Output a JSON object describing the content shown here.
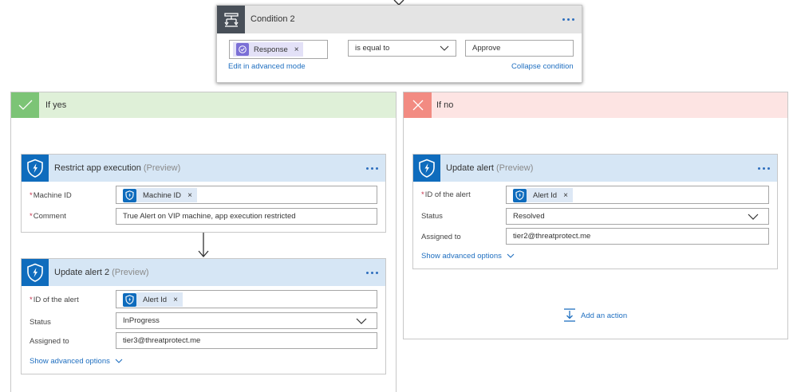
{
  "condition": {
    "title": "Condition 2",
    "left_token": "Response",
    "operator": "is equal to",
    "value": "Approve",
    "edit_advanced": "Edit in advanced mode",
    "collapse": "Collapse condition"
  },
  "if_yes": {
    "title": "If yes",
    "color": "#dff0d8",
    "accent": "#7cc476",
    "restrict": {
      "title": "Restrict app execution",
      "preview": "(Preview)",
      "machine_id_label": "Machine ID",
      "machine_id_token": "Machine ID",
      "comment_label": "Comment",
      "comment_value": "True Alert on VIP machine, app execution restricted"
    },
    "update": {
      "title": "Update alert 2",
      "preview": "(Preview)",
      "alert_id_label": "ID of the alert",
      "alert_id_token": "Alert Id",
      "status_label": "Status",
      "status_value": "InProgress",
      "assigned_label": "Assigned to",
      "assigned_value": "tier3@threatprotect.me",
      "advanced": "Show advanced options"
    }
  },
  "if_no": {
    "title": "If no",
    "color": "#fde4e3",
    "accent": "#f28b82",
    "update": {
      "title": "Update alert",
      "preview": "(Preview)",
      "alert_id_label": "ID of the alert",
      "alert_id_token": "Alert Id",
      "status_label": "Status",
      "status_value": "Resolved",
      "assigned_label": "Assigned to",
      "assigned_value": "tier2@threatprotect.me",
      "advanced": "Show advanced options"
    },
    "add_action": "Add an action"
  },
  "icons": {
    "condition": "condition-icon",
    "approval": "approval-icon",
    "defender": "shield-icon",
    "check": "check-icon",
    "close": "close-icon",
    "add_action": "add-action-icon",
    "more": "more-options-icon",
    "chevron": "chevron-down-icon"
  }
}
